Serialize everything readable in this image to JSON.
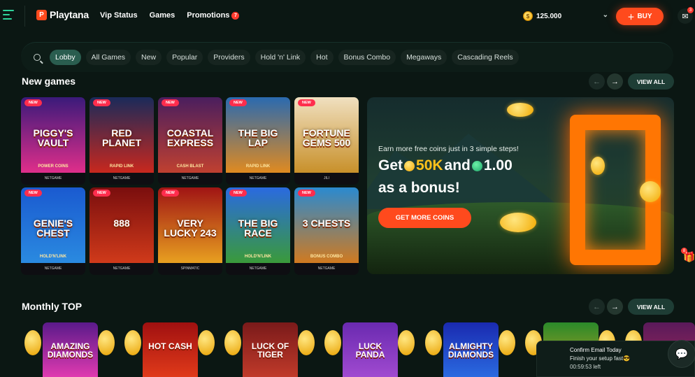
{
  "header": {
    "logo_text": "Playtana",
    "nav": [
      {
        "label": "Vip Status"
      },
      {
        "label": "Games"
      },
      {
        "label": "Promotions",
        "badge": "7"
      }
    ],
    "balance": "125.000",
    "buy_label": "BUY",
    "mail_badge": "3"
  },
  "categories": [
    "Lobby",
    "All Games",
    "New",
    "Popular",
    "Providers",
    "Hold 'n' Link",
    "Hot",
    "Bonus Combo",
    "Megaways",
    "Cascading Reels"
  ],
  "active_category": "Lobby",
  "new_games": {
    "title": "New games",
    "view_all": "VIEW ALL",
    "tiles": [
      {
        "name": "PIGGY'S VAULT",
        "sub": "POWER COINS",
        "provider": "NETGAME",
        "badge": "NEW",
        "c1": "#3a1a7a",
        "c2": "#e02e8a"
      },
      {
        "name": "RED PLANET",
        "sub": "RAPID LINK",
        "provider": "NETGAME",
        "badge": "NEW",
        "c1": "#1a2a5a",
        "c2": "#c8281e"
      },
      {
        "name": "COASTAL EXPRESS",
        "sub": "CASH BLAST",
        "provider": "NETGAME",
        "badge": "NEW",
        "c1": "#4a1e5e",
        "c2": "#c04030"
      },
      {
        "name": "THE BIG LAP",
        "sub": "RAPID LINK",
        "provider": "NETGAME",
        "badge": "NEW",
        "c1": "#2a6ab0",
        "c2": "#e08a20"
      },
      {
        "name": "FORTUNE GEMS 500",
        "sub": "",
        "provider": "JILI",
        "badge": "NEW",
        "c1": "#f0e0c0",
        "c2": "#c8902a"
      },
      {
        "name": "GENIE'S CHEST",
        "sub": "HOLD'N'LINK",
        "provider": "NETGAME",
        "badge": "NEW",
        "c1": "#1a5ad0",
        "c2": "#2a8ae0"
      },
      {
        "name": "888",
        "sub": "",
        "provider": "NETGAME",
        "badge": "NEW",
        "c1": "#7a0e0e",
        "c2": "#d03a1a"
      },
      {
        "name": "VERY LUCKY 243",
        "sub": "",
        "provider": "SPINMATIC",
        "badge": "NEW",
        "c1": "#a01414",
        "c2": "#e8a020"
      },
      {
        "name": "THE BIG RACE",
        "sub": "HOLD'N'LINK",
        "provider": "NETGAME",
        "badge": "NEW",
        "c1": "#2a6ae0",
        "c2": "#3a9a3a"
      },
      {
        "name": "3 CHESTS",
        "sub": "BONUS COMBO",
        "provider": "NETGAME",
        "badge": "NEW",
        "c1": "#2a8ad0",
        "c2": "#d07a20"
      }
    ]
  },
  "banner": {
    "line1": "Earn more free coins just in 3 simple steps!",
    "get": "Get",
    "amount1": "50K",
    "and": "and",
    "amount2": "1.00",
    "line3": "as a bonus!",
    "cta": "GET MORE COINS"
  },
  "gift_badge": "8",
  "monthly_top": {
    "title": "Monthly TOP",
    "view_all": "VIEW ALL",
    "tiles": [
      {
        "name": "AMAZING DIAMONDS",
        "c1": "#5a1a8a",
        "c2": "#e03ab0"
      },
      {
        "name": "HOT CASH",
        "c1": "#a01010",
        "c2": "#e03a1a"
      },
      {
        "name": "LUCK OF TIGER",
        "c1": "#7a1a1a",
        "c2": "#c03a2a"
      },
      {
        "name": "LUCK PANDA",
        "c1": "#6a2ab0",
        "c2": "#a04ad0"
      },
      {
        "name": "ALMIGHTY DIAMONDS",
        "c1": "#1a2ab0",
        "c2": "#2a6ae0"
      },
      {
        "name": "",
        "c1": "#2a8a2a",
        "c2": "#c0a020"
      },
      {
        "name": "",
        "c1": "#5a1a5a",
        "c2": "#a02a5a"
      }
    ]
  },
  "toast": {
    "title": "Confirm Email Today",
    "subtitle": "Finish your setup fast😎",
    "time": "00:59:53 left"
  }
}
